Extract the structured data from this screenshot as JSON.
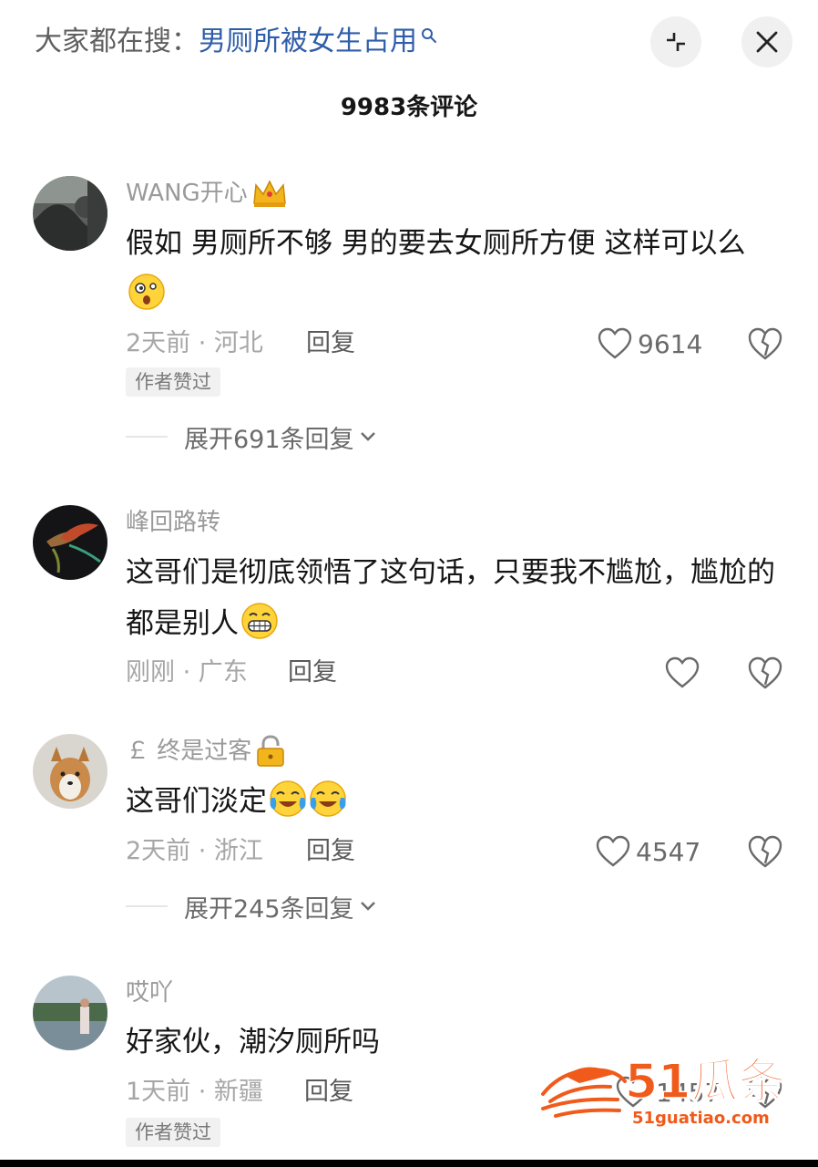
{
  "header": {
    "search_prefix": "大家都在搜：",
    "search_term": "男厕所被女生占用",
    "minimize_icon": "minimize-icon",
    "close_icon": "close-icon"
  },
  "comment_count": "9983条评论",
  "comments": [
    {
      "username": "WANG开心",
      "badge": "crown-emoji",
      "text": "假如 男厕所不够 男的要去女厕所方便 这样可以么",
      "emoji": "dizzy-face-emoji",
      "meta": "2天前 · 河北",
      "reply": "回复",
      "likes": "9614",
      "tag": "作者赞过",
      "expand": "展开691条回复"
    },
    {
      "username": "峰回路转",
      "text": "这哥们是彻底领悟了这句话，只要我不尴尬，尴尬的都是别人",
      "emoji": "grinning-emoji",
      "meta": "刚刚 · 广东",
      "reply": "回复",
      "likes": ""
    },
    {
      "username": "￡ 终是过客",
      "badge": "lock-emoji",
      "text": "这哥们淡定",
      "emoji": "tears-of-joy-emoji",
      "meta": "2天前 · 浙江",
      "reply": "回复",
      "likes": "4547",
      "expand": "展开245条回复"
    },
    {
      "username": "哎吖",
      "text": "好家伙，潮汐厕所吗",
      "meta": "1天前 · 新疆",
      "reply": "回复",
      "likes": "1457",
      "tag": "作者赞过"
    }
  ],
  "watermark": {
    "brand": "51瓜条",
    "url": "51guatiao.com"
  },
  "colors": {
    "search_term": "#2f5ea8",
    "watermark": "#f05a1a"
  }
}
